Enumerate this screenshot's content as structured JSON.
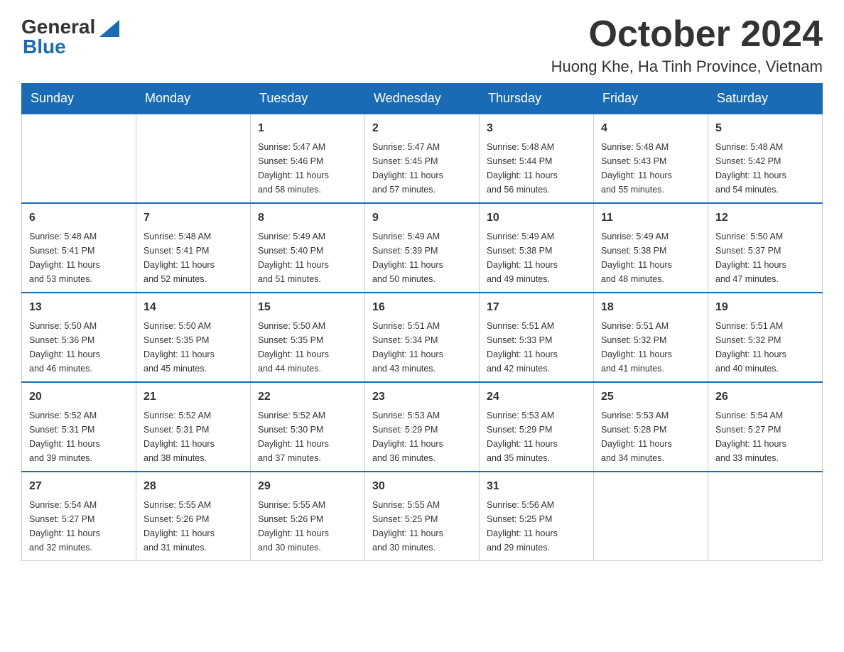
{
  "header": {
    "logo_general": "General",
    "logo_blue": "Blue",
    "month_title": "October 2024",
    "location": "Huong Khe, Ha Tinh Province, Vietnam"
  },
  "weekdays": [
    "Sunday",
    "Monday",
    "Tuesday",
    "Wednesday",
    "Thursday",
    "Friday",
    "Saturday"
  ],
  "weeks": [
    [
      {
        "day": "",
        "info": ""
      },
      {
        "day": "",
        "info": ""
      },
      {
        "day": "1",
        "info": "Sunrise: 5:47 AM\nSunset: 5:46 PM\nDaylight: 11 hours\nand 58 minutes."
      },
      {
        "day": "2",
        "info": "Sunrise: 5:47 AM\nSunset: 5:45 PM\nDaylight: 11 hours\nand 57 minutes."
      },
      {
        "day": "3",
        "info": "Sunrise: 5:48 AM\nSunset: 5:44 PM\nDaylight: 11 hours\nand 56 minutes."
      },
      {
        "day": "4",
        "info": "Sunrise: 5:48 AM\nSunset: 5:43 PM\nDaylight: 11 hours\nand 55 minutes."
      },
      {
        "day": "5",
        "info": "Sunrise: 5:48 AM\nSunset: 5:42 PM\nDaylight: 11 hours\nand 54 minutes."
      }
    ],
    [
      {
        "day": "6",
        "info": "Sunrise: 5:48 AM\nSunset: 5:41 PM\nDaylight: 11 hours\nand 53 minutes."
      },
      {
        "day": "7",
        "info": "Sunrise: 5:48 AM\nSunset: 5:41 PM\nDaylight: 11 hours\nand 52 minutes."
      },
      {
        "day": "8",
        "info": "Sunrise: 5:49 AM\nSunset: 5:40 PM\nDaylight: 11 hours\nand 51 minutes."
      },
      {
        "day": "9",
        "info": "Sunrise: 5:49 AM\nSunset: 5:39 PM\nDaylight: 11 hours\nand 50 minutes."
      },
      {
        "day": "10",
        "info": "Sunrise: 5:49 AM\nSunset: 5:38 PM\nDaylight: 11 hours\nand 49 minutes."
      },
      {
        "day": "11",
        "info": "Sunrise: 5:49 AM\nSunset: 5:38 PM\nDaylight: 11 hours\nand 48 minutes."
      },
      {
        "day": "12",
        "info": "Sunrise: 5:50 AM\nSunset: 5:37 PM\nDaylight: 11 hours\nand 47 minutes."
      }
    ],
    [
      {
        "day": "13",
        "info": "Sunrise: 5:50 AM\nSunset: 5:36 PM\nDaylight: 11 hours\nand 46 minutes."
      },
      {
        "day": "14",
        "info": "Sunrise: 5:50 AM\nSunset: 5:35 PM\nDaylight: 11 hours\nand 45 minutes."
      },
      {
        "day": "15",
        "info": "Sunrise: 5:50 AM\nSunset: 5:35 PM\nDaylight: 11 hours\nand 44 minutes."
      },
      {
        "day": "16",
        "info": "Sunrise: 5:51 AM\nSunset: 5:34 PM\nDaylight: 11 hours\nand 43 minutes."
      },
      {
        "day": "17",
        "info": "Sunrise: 5:51 AM\nSunset: 5:33 PM\nDaylight: 11 hours\nand 42 minutes."
      },
      {
        "day": "18",
        "info": "Sunrise: 5:51 AM\nSunset: 5:32 PM\nDaylight: 11 hours\nand 41 minutes."
      },
      {
        "day": "19",
        "info": "Sunrise: 5:51 AM\nSunset: 5:32 PM\nDaylight: 11 hours\nand 40 minutes."
      }
    ],
    [
      {
        "day": "20",
        "info": "Sunrise: 5:52 AM\nSunset: 5:31 PM\nDaylight: 11 hours\nand 39 minutes."
      },
      {
        "day": "21",
        "info": "Sunrise: 5:52 AM\nSunset: 5:31 PM\nDaylight: 11 hours\nand 38 minutes."
      },
      {
        "day": "22",
        "info": "Sunrise: 5:52 AM\nSunset: 5:30 PM\nDaylight: 11 hours\nand 37 minutes."
      },
      {
        "day": "23",
        "info": "Sunrise: 5:53 AM\nSunset: 5:29 PM\nDaylight: 11 hours\nand 36 minutes."
      },
      {
        "day": "24",
        "info": "Sunrise: 5:53 AM\nSunset: 5:29 PM\nDaylight: 11 hours\nand 35 minutes."
      },
      {
        "day": "25",
        "info": "Sunrise: 5:53 AM\nSunset: 5:28 PM\nDaylight: 11 hours\nand 34 minutes."
      },
      {
        "day": "26",
        "info": "Sunrise: 5:54 AM\nSunset: 5:27 PM\nDaylight: 11 hours\nand 33 minutes."
      }
    ],
    [
      {
        "day": "27",
        "info": "Sunrise: 5:54 AM\nSunset: 5:27 PM\nDaylight: 11 hours\nand 32 minutes."
      },
      {
        "day": "28",
        "info": "Sunrise: 5:55 AM\nSunset: 5:26 PM\nDaylight: 11 hours\nand 31 minutes."
      },
      {
        "day": "29",
        "info": "Sunrise: 5:55 AM\nSunset: 5:26 PM\nDaylight: 11 hours\nand 30 minutes."
      },
      {
        "day": "30",
        "info": "Sunrise: 5:55 AM\nSunset: 5:25 PM\nDaylight: 11 hours\nand 30 minutes."
      },
      {
        "day": "31",
        "info": "Sunrise: 5:56 AM\nSunset: 5:25 PM\nDaylight: 11 hours\nand 29 minutes."
      },
      {
        "day": "",
        "info": ""
      },
      {
        "day": "",
        "info": ""
      }
    ]
  ]
}
